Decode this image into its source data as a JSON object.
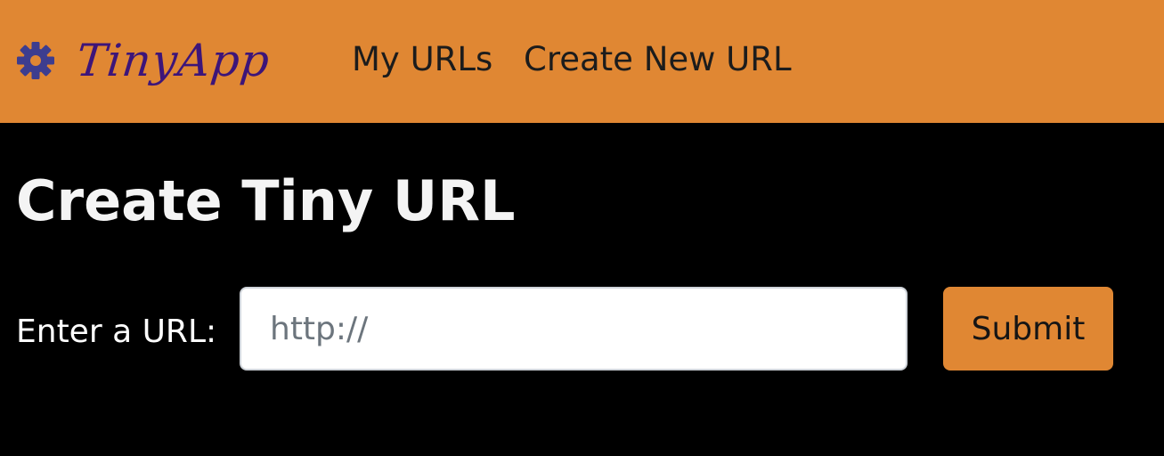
{
  "navbar": {
    "brand": {
      "icon": "gear-icon",
      "text": "TinyApp"
    },
    "links": [
      {
        "label": "My URLs"
      },
      {
        "label": "Create New URL"
      }
    ],
    "background_color": "#e08733"
  },
  "main": {
    "title": "Create Tiny URL",
    "form": {
      "label": "Enter a URL:",
      "input": {
        "value": "",
        "placeholder": "http://"
      },
      "submit_label": "Submit"
    }
  },
  "colors": {
    "accent": "#e08733",
    "brand_text": "#3d1579",
    "gear": "#3d3d8f",
    "page_background": "#000000"
  }
}
